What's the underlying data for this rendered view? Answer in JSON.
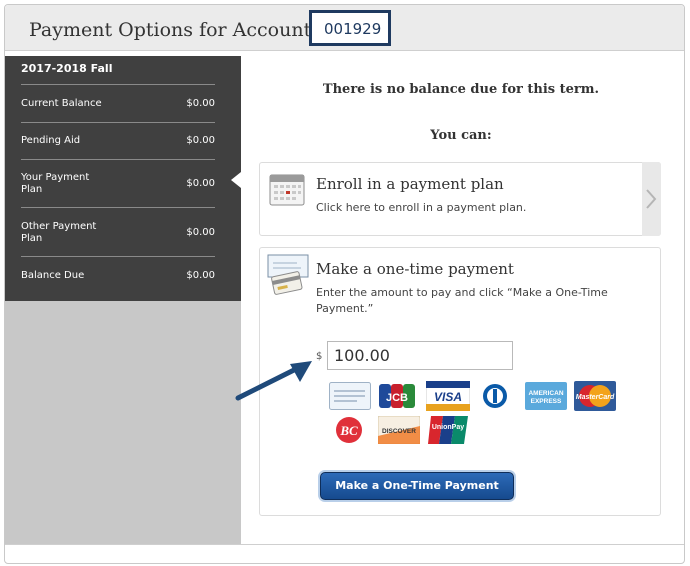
{
  "header": {
    "title": "Payment Options for Account #",
    "account_number": "001929"
  },
  "sidebar": {
    "term": "2017-2018 Fall",
    "items": [
      {
        "label": "Current Balance",
        "value": "$0.00"
      },
      {
        "label": "Pending Aid",
        "value": "$0.00"
      },
      {
        "label": "Your Payment Plan",
        "value": "$0.00"
      },
      {
        "label": "Other Payment Plan",
        "value": "$0.00"
      },
      {
        "label": "Balance Due",
        "value": "$0.00"
      }
    ]
  },
  "main": {
    "no_balance_message": "There is no balance due for this term.",
    "you_can": "You can:",
    "enroll": {
      "title": "Enroll in a payment plan",
      "description": "Click here to enroll in a payment plan.",
      "icon": "calendar-icon"
    },
    "one_time": {
      "title": "Make a one-time payment",
      "description": "Enter the amount to pay and click “Make a One-Time Payment.”",
      "icon": "check-and-card-icon",
      "currency_symbol": "$",
      "amount_value": "100.00",
      "button_label": "Make a One-Time Payment"
    },
    "payment_methods": [
      "eCheck",
      "JCB",
      "VISA",
      "Diners Club",
      "American Express",
      "MasterCard",
      "BC Card",
      "DISCOVER",
      "UnionPay"
    ]
  },
  "colors": {
    "sidebar_bg": "#404040",
    "account_border": "#1f3a60",
    "button_blue": "#1f5aa3",
    "arrow_blue": "#1f4a7a"
  }
}
